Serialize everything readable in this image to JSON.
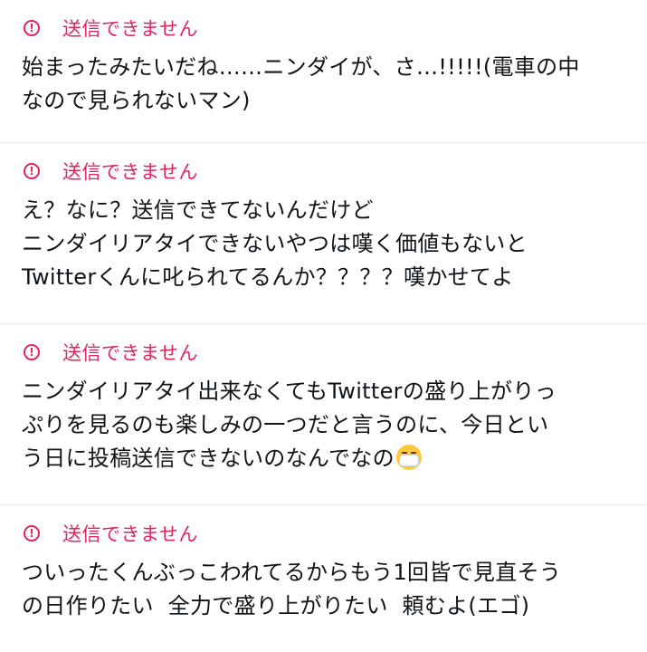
{
  "items": [
    {
      "status_icon": "alert-circle-icon",
      "status": "送信できません",
      "lines": [
        "始まったみたいだね……ニンダイが、さ…!!!!!(電車の中",
        "なので見られないマン)"
      ]
    },
    {
      "status_icon": "alert-circle-icon",
      "status": "送信できません",
      "lines": [
        "え？なに？送信できてないんだけど",
        "ニンダイリアタイできないやつは嘆く価値もないと",
        "Twitterくんに叱られてるんか？？？？嘆かせてよ"
      ]
    },
    {
      "status_icon": "alert-circle-icon",
      "status": "送信できません",
      "lines": [
        "ニンダイリアタイ出来なくてもTwitterの盛り上がりっ",
        "ぷりを見るのも楽しみの一つだと言うのに、今日とい",
        "う日に投稿送信できないのなんでなの"
      ],
      "emoji": "face-with-medical-mask-icon"
    },
    {
      "status_icon": "alert-circle-icon",
      "status": "送信できません",
      "lines": [
        "ついったくんぶっこわれてるからもう1回皆で見直そう",
        "の日作りたい  全力で盛り上がりたい  頼むよ(エゴ)"
      ]
    }
  ],
  "colors": {
    "error": "#e0245e",
    "text": "#0f1419",
    "divider": "#e6e9eb"
  }
}
